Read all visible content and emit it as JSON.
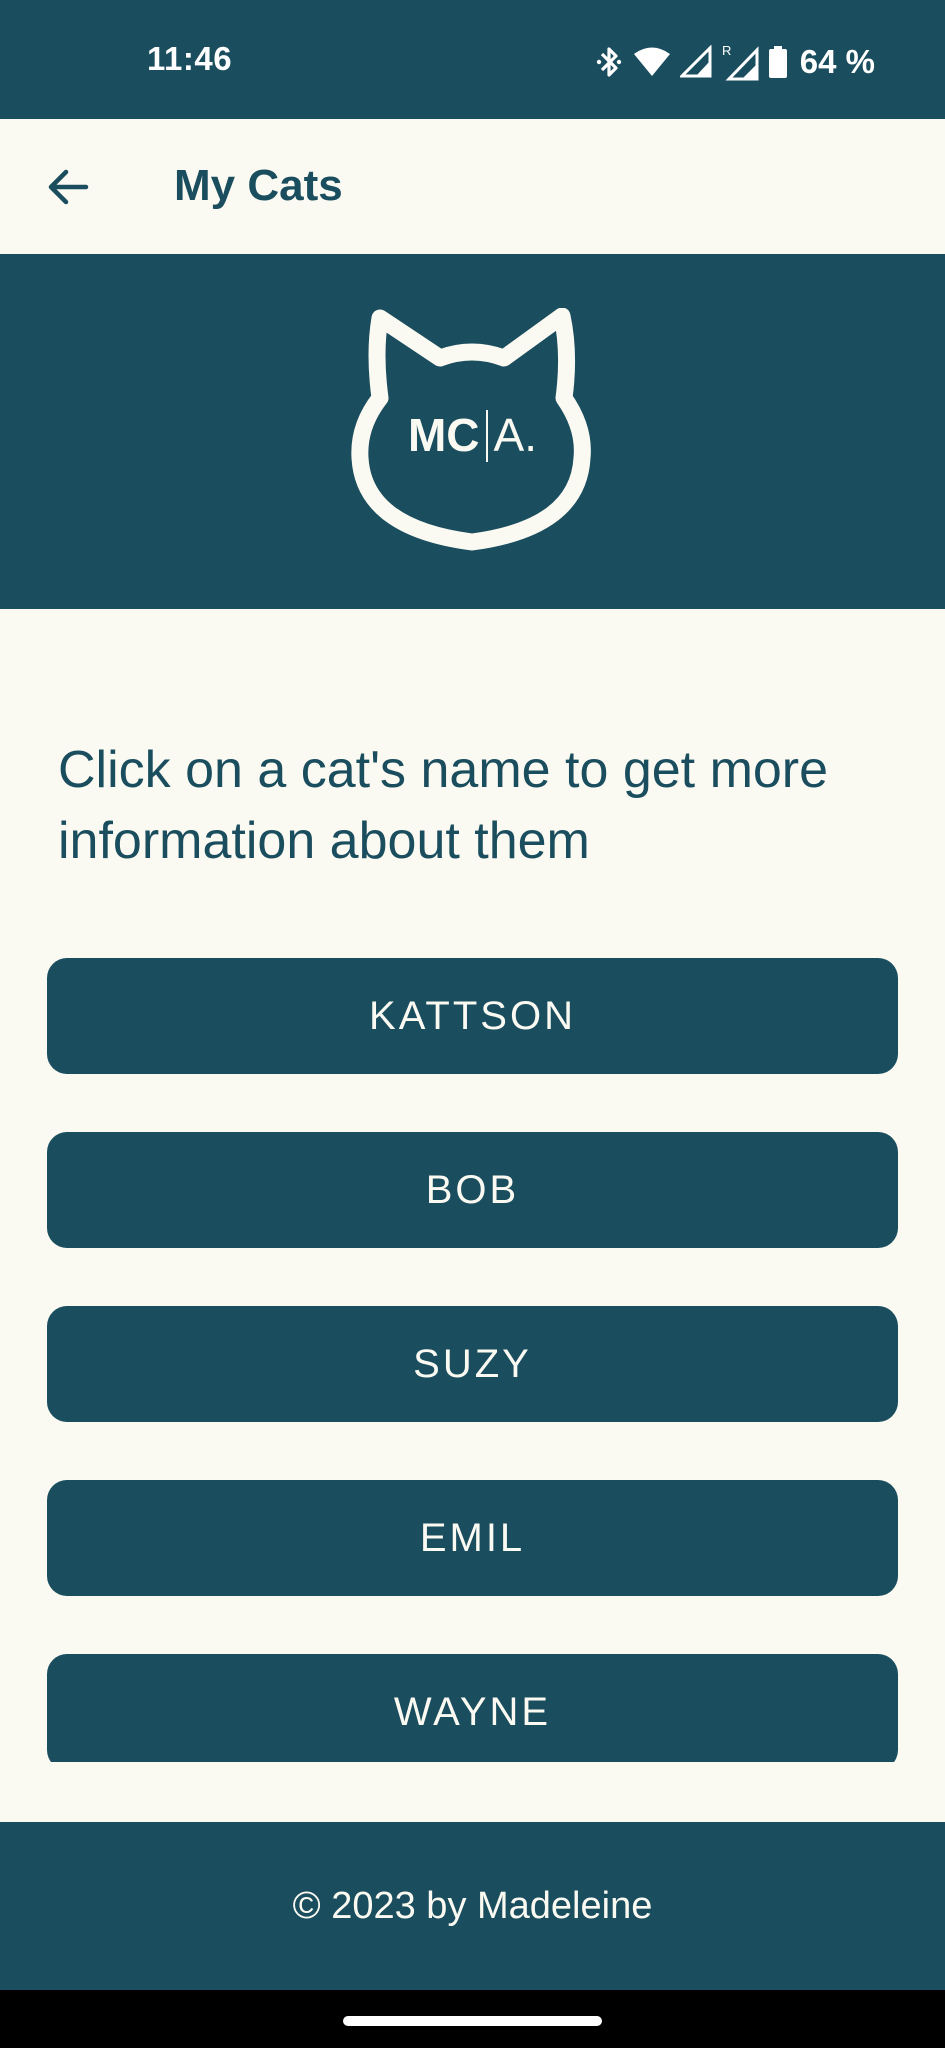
{
  "status_bar": {
    "time": "11:46",
    "battery": "64 %",
    "icons": [
      "bluetooth-icon",
      "wifi-icon",
      "signal-icon",
      "roaming-signal-icon",
      "battery-icon"
    ]
  },
  "app_bar": {
    "title": "My Cats",
    "back_icon": "arrow-back-icon"
  },
  "hero": {
    "logo_mc": "MC",
    "logo_a": "A."
  },
  "intro": "Click on a cat's name to get more information about them",
  "cats": [
    "KATTSON",
    "BOB",
    "SUZY",
    "EMIL",
    "WAYNE"
  ],
  "footer": "© 2023 by Madeleine",
  "colors": {
    "primary": "#1a4d5e",
    "background": "#fbfaf2",
    "on_primary": "#fbfaf2"
  }
}
